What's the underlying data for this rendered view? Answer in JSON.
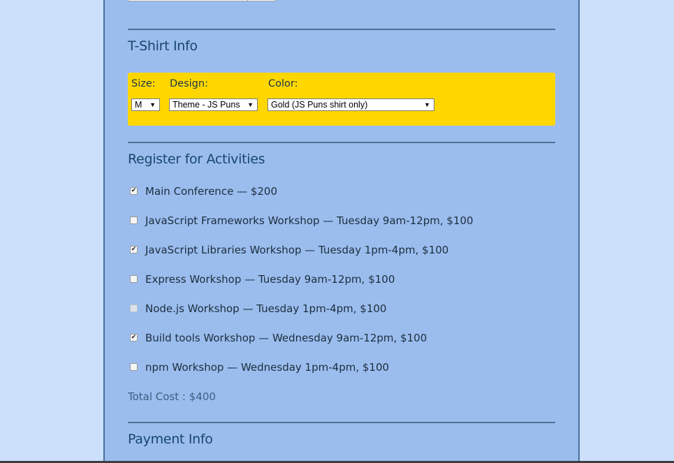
{
  "tshirt": {
    "title": "T-Shirt Info",
    "size_label": "Size:",
    "size_value": "M",
    "design_label": "Design:",
    "design_value": "Theme - JS Puns",
    "color_label": "Color:",
    "color_value": "Gold (JS Puns shirt only)"
  },
  "activities": {
    "title": "Register for Activities",
    "items": [
      {
        "label": "Main Conference — $200",
        "checked": true,
        "disabled": false
      },
      {
        "label": "JavaScript Frameworks Workshop — Tuesday 9am-12pm, $100",
        "checked": false,
        "disabled": false
      },
      {
        "label": "JavaScript Libraries Workshop — Tuesday 1pm-4pm, $100",
        "checked": true,
        "disabled": false
      },
      {
        "label": "Express Workshop — Tuesday 9am-12pm, $100",
        "checked": false,
        "disabled": false
      },
      {
        "label": "Node.js Workshop — Tuesday 1pm-4pm, $100",
        "checked": false,
        "disabled": true
      },
      {
        "label": "Build tools Workshop — Wednesday 9am-12pm, $100",
        "checked": true,
        "disabled": false
      },
      {
        "label": "npm Workshop — Wednesday 1pm-4pm, $100",
        "checked": false,
        "disabled": false
      }
    ],
    "total": "Total Cost : $400"
  },
  "payment": {
    "title": "Payment Info"
  },
  "icons": {
    "select_arrow": "dropdown-arrow-icon",
    "checkmark": "checkmark-icon"
  },
  "colors": {
    "page_background": "#cce0fb",
    "form_background": "#9bbdee",
    "tshirt_panel": "#ffd700",
    "heading": "#18476b",
    "total_text": "#3d5f82"
  }
}
